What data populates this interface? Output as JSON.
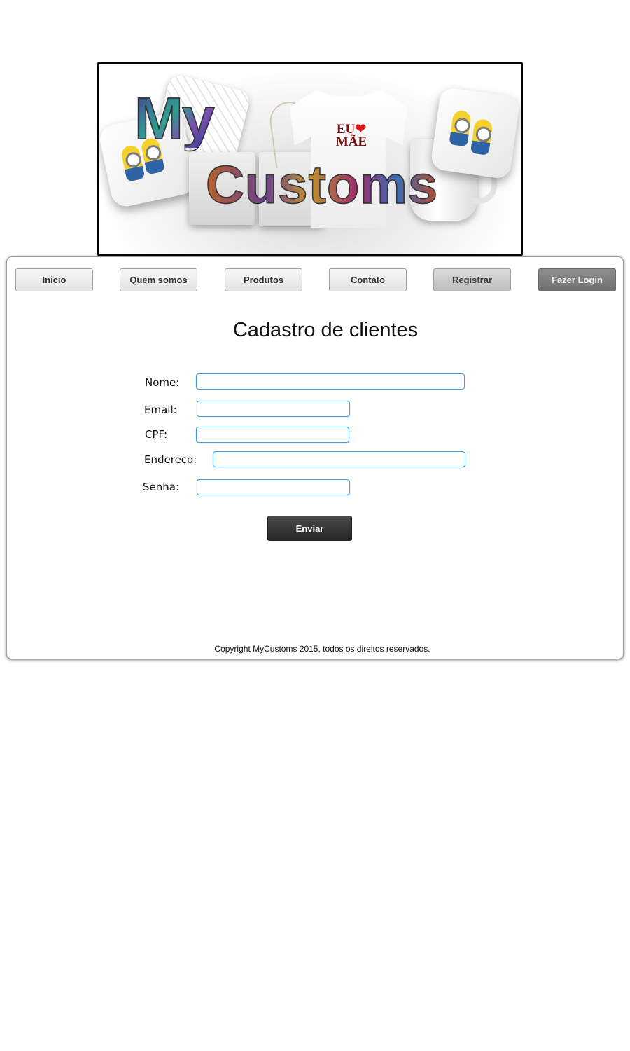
{
  "banner": {
    "logo_line1": "My",
    "logo_line2": "Customs",
    "shirt_text_line1": "EU",
    "shirt_text_line2": "MÃE",
    "heart_icon": "heart-icon"
  },
  "nav": {
    "items": [
      {
        "label": "Inicio"
      },
      {
        "label": "Quem somos"
      },
      {
        "label": "Produtos"
      },
      {
        "label": "Contato"
      },
      {
        "label": "Registrar"
      },
      {
        "label": "Fazer Login"
      }
    ]
  },
  "form": {
    "title": "Cadastro de clientes",
    "fields": {
      "nome": {
        "label": "Nome:",
        "value": ""
      },
      "email": {
        "label": "Email:",
        "value": ""
      },
      "cpf": {
        "label": "CPF:",
        "value": ""
      },
      "endereco": {
        "label": "Endereço:",
        "value": ""
      },
      "senha": {
        "label": "Senha:",
        "value": ""
      }
    },
    "submit_label": "Enviar"
  },
  "footer": {
    "text": "Copyright MyCustoms 2015, todos os direitos reservados."
  },
  "colors": {
    "input_border": "#3aa0e0",
    "submit_bg": "#333333",
    "login_bg": "#7f7f7f"
  }
}
